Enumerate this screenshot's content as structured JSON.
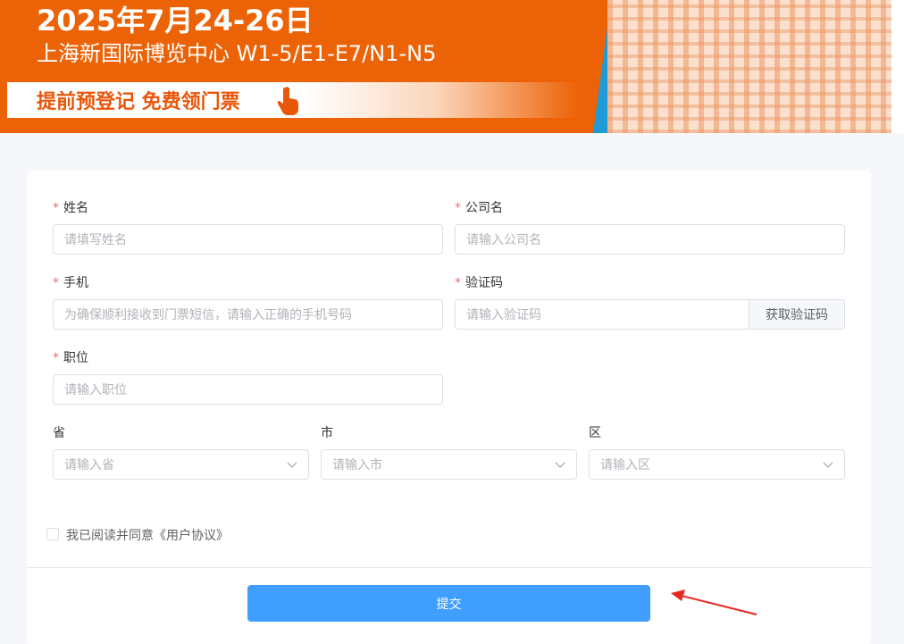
{
  "banner": {
    "date": "2025年7月24-26日",
    "venue": "上海新国际博览中心 W1-5/E1-E7/N1-N5",
    "cta": "提前预登记 免费领门票",
    "colors": {
      "orange": "#ec6206",
      "blue": "#1e9bd7",
      "green": "#c5d21d"
    }
  },
  "form": {
    "required_mark": "*",
    "name": {
      "label": "姓名",
      "placeholder": "请填写姓名"
    },
    "company": {
      "label": "公司名",
      "placeholder": "请输入公司名"
    },
    "phone": {
      "label": "手机",
      "placeholder": "为确保顺利接收到门票短信，请输入正确的手机号码"
    },
    "code": {
      "label": "验证码",
      "placeholder": "请输入验证码",
      "button": "获取验证码"
    },
    "position": {
      "label": "职位",
      "placeholder": "请输入职位"
    },
    "province": {
      "label": "省",
      "placeholder": "请输入省"
    },
    "city": {
      "label": "市",
      "placeholder": "请输入市"
    },
    "district": {
      "label": "区",
      "placeholder": "请输入区"
    },
    "agreement": "我已阅读并同意《用户协议》",
    "agreement_checked": false,
    "submit": "提交",
    "accent": "#409eff",
    "required_color": "#f56c6c"
  },
  "annotation": {
    "color": "#e8281e",
    "icon": "red-arrow-icon"
  }
}
